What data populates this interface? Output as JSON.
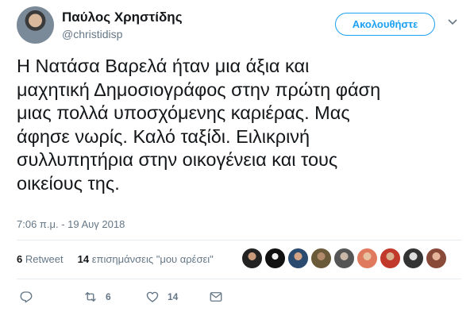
{
  "author": {
    "name": "Παύλος Χρηστίδης",
    "handle": "@christidisp"
  },
  "follow_button": "Ακολουθήστε",
  "tweet": {
    "lines": [
      "Η Νατάσα Βαρελά ήταν μια άξια και",
      "μαχητική Δημοσιογράφος στην πρώτη φάση",
      "μιας πολλά υποσχόμενης καριέρας. Μας",
      "άφησε νωρίς. Καλό ταξίδι. Ειλικρινή",
      "συλλυπητήρια στην οικογένεια και τους",
      "οικείους της."
    ],
    "timestamp": "7:06 π.μ. - 19 Αυγ 2018"
  },
  "stats": {
    "retweets_count": "6",
    "retweets_label": "Retweet",
    "likes_count": "14",
    "likes_label": "επισημάνσεις \"μου αρέσει\""
  },
  "actions": {
    "reply_icon": "reply-icon",
    "retweet_icon": "retweet-icon",
    "retweet_count": "6",
    "like_icon": "heart-icon",
    "like_count": "14",
    "dm_icon": "envelope-icon"
  },
  "colors": {
    "accent": "#1da1f2",
    "muted": "#657786",
    "text": "#14171a",
    "divider": "#e6ecf0"
  }
}
